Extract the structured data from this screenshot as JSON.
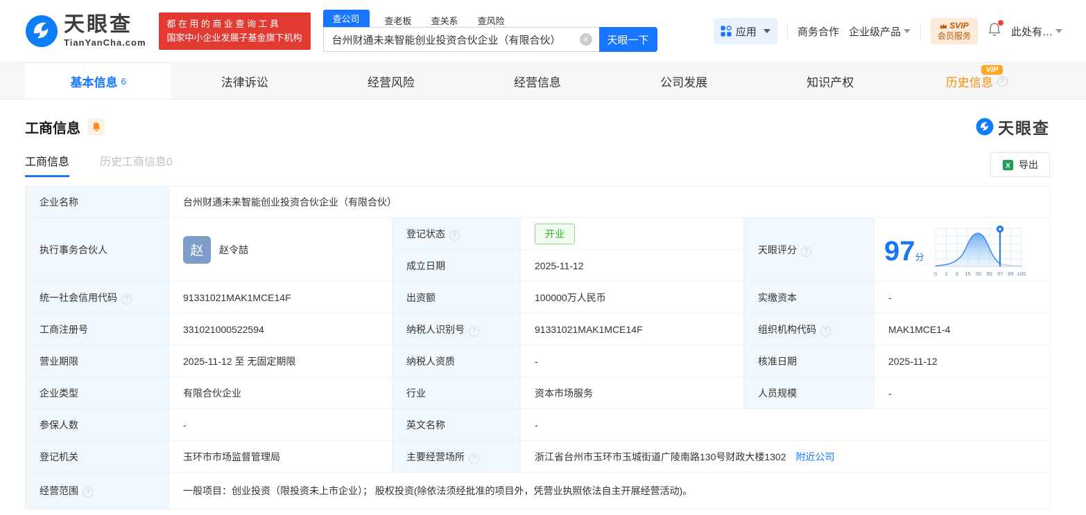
{
  "header": {
    "logo": {
      "title": "天眼查",
      "domain": "TianYanCha.com"
    },
    "banner": {
      "line1": "都在用的商业查询工具",
      "line2": "国家中小企业发展子基金旗下机构"
    },
    "search": {
      "tabs": [
        {
          "label": "查公司"
        },
        {
          "label": "查老板"
        },
        {
          "label": "查关系"
        },
        {
          "label": "查风险"
        }
      ],
      "value": "台州财通未来智能创业投资合伙企业（有限合伙）",
      "button": "天眼一下"
    },
    "menu": {
      "apps": "应用",
      "coop": "商务合作",
      "enterprise": "企业级产品",
      "svip_line1": "SVIP",
      "svip_line2": "会员服务",
      "more": "此处有…"
    }
  },
  "nav": {
    "tabs": [
      {
        "label": "基本信息",
        "count": "6"
      },
      {
        "label": "法律诉讼"
      },
      {
        "label": "经营风险"
      },
      {
        "label": "经营信息"
      },
      {
        "label": "公司发展"
      },
      {
        "label": "知识产权"
      },
      {
        "label": "历史信息",
        "vip": "VIP"
      }
    ]
  },
  "section": {
    "title": "工商信息",
    "watermark": "天眼查"
  },
  "subtabs": {
    "current": "工商信息",
    "history": "历史工商信息0",
    "export": "导出"
  },
  "info": {
    "company_name_label": "企业名称",
    "company_name": "台州财通未来智能创业投资合伙企业（有限合伙）",
    "partner_label": "执行事务合伙人",
    "partner_avatar": "赵",
    "partner_name": "赵令喆",
    "reg_status_label": "登记状态",
    "reg_status": "开业",
    "est_date_label": "成立日期",
    "est_date": "2025-11-12",
    "score_label": "天眼评分",
    "score": "97",
    "score_unit": "分",
    "uscc_label": "统一社会信用代码",
    "uscc": "91331021MAK1MCE14F",
    "capital_label": "出资额",
    "capital": "100000万人民币",
    "paid_label": "实缴资本",
    "paid": "-",
    "regno_label": "工商注册号",
    "regno": "331021000522594",
    "taxid_label": "纳税人识别号",
    "taxid": "91331021MAK1MCE14F",
    "orgcode_label": "组织机构代码",
    "orgcode": "MAK1MCE1-4",
    "term_label": "营业期限",
    "term": "2025-11-12 至 无固定期限",
    "taxq_label": "纳税人资质",
    "taxq": "-",
    "approve_label": "核准日期",
    "approve": "2025-11-12",
    "type_label": "企业类型",
    "type": "有限合伙企业",
    "industry_label": "行业",
    "industry": "资本市场服务",
    "staff_label": "人员规模",
    "staff": "-",
    "insured_label": "参保人数",
    "insured": "-",
    "en_label": "英文名称",
    "en": "-",
    "authority_label": "登记机关",
    "authority": "玉环市市场监督管理局",
    "address_label": "主要经营场所",
    "address": "浙江省台州市玉环市玉城街道广陵南路130号财政大楼1302",
    "nearby_link": "附近公司",
    "scope_label": "经营范围",
    "scope": "一般项目：创业投资（限投资未上市企业）； 股权投资(除依法须经批准的项目外，凭营业执照依法自主开展经营活动)。"
  },
  "score_chart": {
    "type": "area",
    "ticks": [
      "0",
      "1",
      "3",
      "15",
      "50",
      "85",
      "97",
      "99",
      "100"
    ],
    "marker_value": "97"
  },
  "colors": {
    "accent": "#1775ff",
    "banner_red": "#e23a32",
    "status_green": "#2fae2f",
    "history_orange": "#ff8a00"
  }
}
